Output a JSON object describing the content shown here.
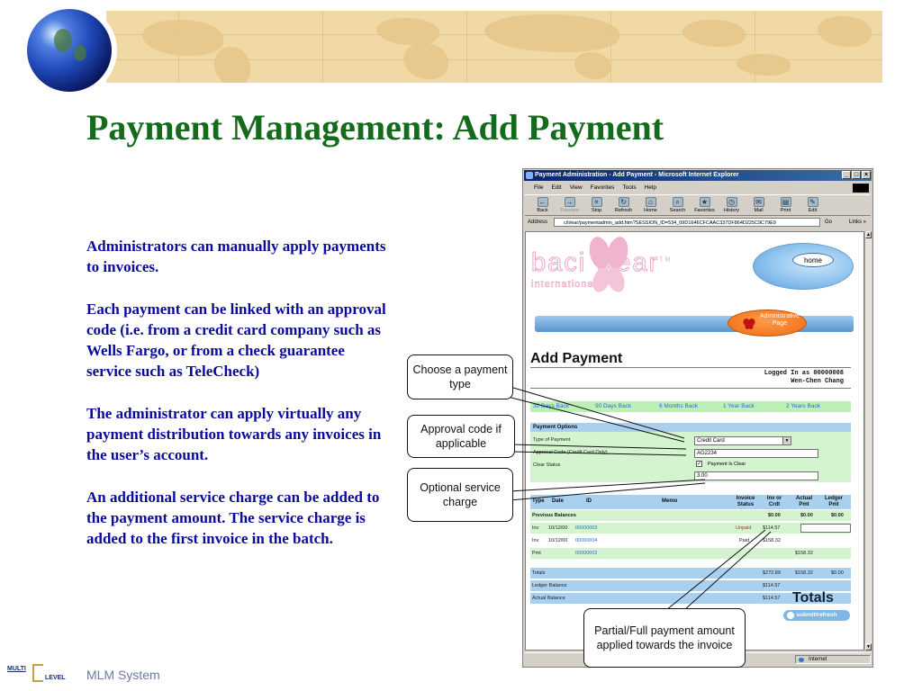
{
  "slide": {
    "title": "Payment Management: Add Payment",
    "paragraphs": [
      "Administrators can manually apply payments to invoices.",
      "Each payment can be linked with an approval code (i.e. from a credit card company such as Wells Fargo, or from a check guarantee service such as TeleCheck)",
      "The administrator can apply virtually any payment distribution towards any invoices in the user’s account.",
      "An additional service charge can be added to the payment amount.  The service charge is added to the first invoice in the batch."
    ],
    "footer": "MLM System",
    "footer_logo_top": "MULTI",
    "footer_logo_bottom": "LEVEL"
  },
  "callouts": {
    "payment_type": "Choose a payment type",
    "approval_code": "Approval code if applicable",
    "service_charge": "Optional service charge",
    "partial_full": "Partial/Full payment amount applied towards the invoice"
  },
  "browser": {
    "title": "Payment Administration - Add Payment - Microsoft Internet Explorer",
    "menu": [
      "File",
      "Edit",
      "View",
      "Favorites",
      "Tools",
      "Help"
    ],
    "toolbar": [
      {
        "label": "Back",
        "icon": "back-arrow-icon"
      },
      {
        "label": "Forward",
        "icon": "forward-arrow-icon"
      },
      {
        "label": "Stop",
        "icon": "stop-icon"
      },
      {
        "label": "Refresh",
        "icon": "refresh-icon"
      },
      {
        "label": "Home",
        "icon": "home-icon"
      },
      {
        "label": "Search",
        "icon": "search-icon"
      },
      {
        "label": "Favorites",
        "icon": "favorites-icon"
      },
      {
        "label": "History",
        "icon": "history-icon"
      },
      {
        "label": "Mail",
        "icon": "mail-icon"
      },
      {
        "label": "Print",
        "icon": "print-icon"
      },
      {
        "label": "Edit",
        "icon": "edit-icon"
      }
    ],
    "address_label": "Address",
    "address_value": "c/ii/ear/paymentadmin_add.htm?SESSION_ID=534_09D1646CFCAAC337DF864D225C9C79E9",
    "go_label": "Go",
    "links_label": "Links »",
    "status_zone": "Internet"
  },
  "page": {
    "logo_text": "baci wear",
    "logo_tm": "TM",
    "logo_sub": "international",
    "home_button": "home",
    "admin_badge": "Administrative Page",
    "heading": "Add Payment",
    "logged_in": "Logged In as 00000008",
    "user_name": "Wen-Chen Chang",
    "periods": [
      "30 Days Back",
      "90 Days Back",
      "6 Months Back",
      "1 Year Back",
      "2 Years Back"
    ],
    "options_header": "Payment Options",
    "labels": {
      "type_of_payment": "Type of Payment",
      "approval_code": "Approval Code (Credit Card Only)",
      "clear_status": "Clear Status"
    },
    "payment_type_value": "Credit Card",
    "approval_code_value": "AG2234",
    "payment_is_clear_label": "Payment Is Clear",
    "payment_is_clear_checked": true,
    "service_charge_value": "3.00",
    "table_headers": [
      "Type",
      "Date",
      "ID",
      "Memo",
      "Invoice Status",
      "Inv or Crdt",
      "Actual Pmt",
      "Ledger Pmt"
    ],
    "previous_balances_label": "Previous Balances",
    "previous_balances": [
      "$0.00",
      "$0.00",
      "$0.00"
    ],
    "rows": [
      {
        "type": "Inv",
        "date": "10/12/00",
        "id": "00000003",
        "status": "Unpaid",
        "amount": "$114.57",
        "actual": "",
        "ledger": ""
      },
      {
        "type": "Inv",
        "date": "10/12/00",
        "id": "00000004",
        "status": "Paid",
        "amount": "$158.32",
        "actual": "",
        "ledger": ""
      },
      {
        "type": "Pmt",
        "date": "",
        "id": "00000002",
        "status": "",
        "amount": "",
        "actual": "$158.32",
        "ledger": ""
      }
    ],
    "totals_label": "Totals",
    "totals": [
      "$272.89",
      "$158.32",
      "$0.00"
    ],
    "ledger_balance_label": "Ledger Balance",
    "ledger_balance": "$114.57",
    "actual_balance_label": "Actual Balance",
    "actual_balance": "$114.57",
    "totals_heading": "Totals",
    "submit_label": "submit/refresh"
  }
}
